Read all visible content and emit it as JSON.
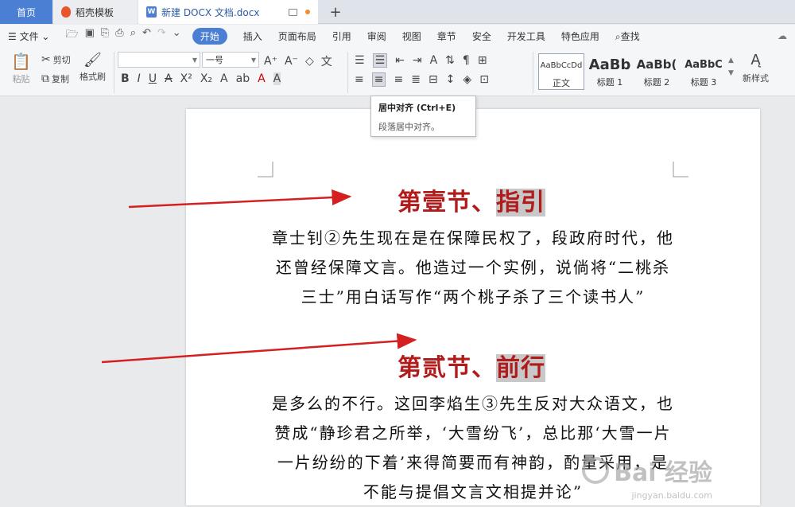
{
  "tabs": {
    "home": "首页",
    "docer": "稻壳模板",
    "document": "新建 DOCX 文档.docx",
    "new_tab": "+"
  },
  "menu": {
    "file": "文件",
    "items": [
      "开始",
      "插入",
      "页面布局",
      "引用",
      "审阅",
      "视图",
      "章节",
      "安全",
      "开发工具",
      "特色应用"
    ],
    "search": "查找"
  },
  "ribbon": {
    "cut": "剪切",
    "copy": "复制",
    "paste": "粘贴",
    "format_painter": "格式刷",
    "font_name": "",
    "font_size": "一号",
    "styles": [
      {
        "preview": "AaBbCcDd",
        "name": "正文"
      },
      {
        "preview": "AaBb",
        "name": "标题 1"
      },
      {
        "preview": "AaBb(",
        "name": "标题 2"
      },
      {
        "preview": "AaBbC",
        "name": "标题 3"
      }
    ],
    "new_style": "新样式"
  },
  "tooltip": {
    "title": "居中对齐 (Ctrl+E)",
    "desc": "段落居中对齐。"
  },
  "document": {
    "heading1_a": "第壹节、",
    "heading1_b": "指引",
    "para1": "章士钊②先生现在是在保障民权了，段政府时代，他还曾经保障文言。他造过一个实例，说倘将“二桃杀三士”用白话写作“两个桃子杀了三个读书人”",
    "heading2_a": "第贰节、",
    "heading2_b": "前行",
    "para2": "是多么的不行。这回李焰生③先生反对大众语文，也赞成“静珍君之所举，‘大雪纷飞’，总比那‘大雪一片一片纷纷的下着’来得简要而有神韵，酌量采用，是不能与提倡文言文相提并论”"
  },
  "watermark": {
    "text": "Bai 经验",
    "url": "jingyan.baidu.com"
  },
  "colors": {
    "accent": "#4a7fd3",
    "heading": "#b01c1c",
    "arrow": "#d42020"
  }
}
